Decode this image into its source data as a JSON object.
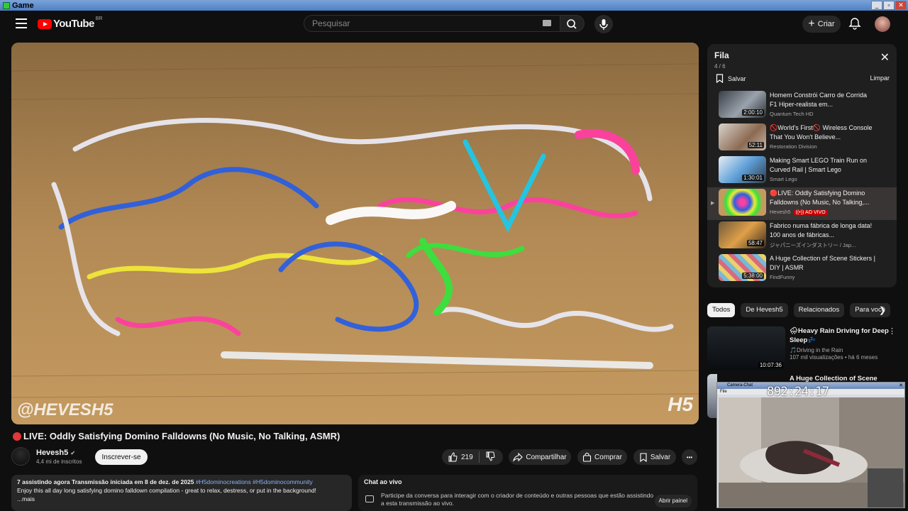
{
  "window": {
    "title": "Game"
  },
  "header": {
    "logo_text": "YouTube",
    "logo_region": "BR",
    "search_placeholder": "Pesquisar",
    "create_label": "Criar"
  },
  "player": {
    "watermark_left": "@HEVESH5",
    "watermark_right": "H5"
  },
  "video": {
    "title": "LIVE: Oddly Satisfying Domino Falldowns (No Music, No Talking, ASMR)",
    "channel": "Hevesh5",
    "subscribers": "4,4 mi de inscritos",
    "subscribe_label": "Inscrever-se",
    "likes": "219",
    "share_label": "Compartilhar",
    "buy_label": "Comprar",
    "save_label": "Salvar",
    "more_label": "•••"
  },
  "description": {
    "stats": "7 assistindo agora  Transmissão iniciada em 8 de dez. de 2025",
    "tags": "#H5dominocreations #H5dominocommunity",
    "text": "Enjoy this all day long satisfying domino falldown compilation - great to relax, destress, or put in the background!",
    "more": "...mais"
  },
  "chat": {
    "title": "Chat ao vivo",
    "text": "Participe da conversa para interagir com o criador de conteúdo e outras pessoas que estão assistindo a esta transmissão ao vivo.",
    "button": "Abrir painel"
  },
  "queue": {
    "title": "Fila",
    "count": "4 / 6",
    "save_label": "Salvar",
    "clear_label": "Limpar",
    "close_label": "✕",
    "items": [
      {
        "title": "Homem Constrói Carro de Corrida F1 Hiper-realista em...",
        "channel": "Quantum Tech HD",
        "duration": "2:00:10",
        "active": false
      },
      {
        "title": "🚫World's First🚫 Wireless Console That You Won't Believe...",
        "channel": "Restoration Division",
        "duration": "52:11",
        "active": false
      },
      {
        "title": "Making Smart LEGO Train Run on Curved Rail | Smart Lego",
        "channel": "Smart Lego",
        "duration": "1:30:01",
        "active": false
      },
      {
        "title": "🔴LIVE: Oddly Satisfying Domino Falldowns (No Music, No Talking,...",
        "channel": "Hevesh5",
        "duration": "",
        "badge": "((•)) AO VIVO",
        "active": true
      },
      {
        "title": "Fabrico numa fábrica de longa data! 100 anos de fábricas...",
        "channel": "ジャパニーズインダストリー / Jap...",
        "duration": "58:47",
        "active": false
      },
      {
        "title": "A Huge Collection of Scene Stickers | DIY | ASMR",
        "channel": "FindFunny",
        "duration": "5:38:00",
        "active": false
      }
    ]
  },
  "chips": [
    "Todos",
    "De Hevesh5",
    "Relacionados",
    "Para você"
  ],
  "related": [
    {
      "title": "🌧Heavy Rain Driving for Deep Sleep💤",
      "channel": "🎵Driving in the Rain",
      "meta": "107 mil visualizações • há 6 meses",
      "duration": "10:07:36"
    },
    {
      "title": "A Huge Collection of Scene"
    }
  ],
  "camera": {
    "title": "Camera-Chat",
    "menu": "File",
    "timer": "892:24:17"
  },
  "colors": {
    "accent": "#ff0000",
    "background": "#0f0f0f",
    "live": "#cc0000"
  }
}
